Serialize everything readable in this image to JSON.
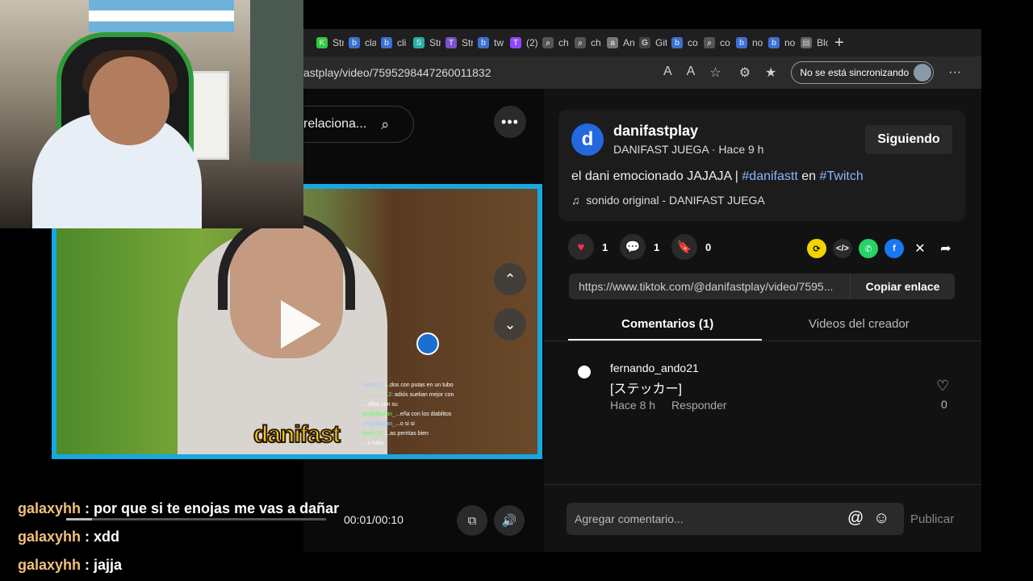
{
  "browser": {
    "tabs": [
      {
        "label": "Str",
        "color": "#2ecc40",
        "glyph": "K"
      },
      {
        "label": "cla",
        "color": "#3b6fd8",
        "glyph": "b"
      },
      {
        "label": "cli",
        "color": "#3b6fd8",
        "glyph": "b"
      },
      {
        "label": "Str",
        "color": "#20b2aa",
        "glyph": "S"
      },
      {
        "label": "Str",
        "color": "#7a4fd0",
        "glyph": "T"
      },
      {
        "label": "tw",
        "color": "#3b6fd8",
        "glyph": "b"
      },
      {
        "label": "(2)",
        "color": "#9146ff",
        "glyph": "T"
      },
      {
        "label": "ch",
        "color": "#555555",
        "glyph": "⌕"
      },
      {
        "label": "ch",
        "color": "#555555",
        "glyph": "⌕"
      },
      {
        "label": "An",
        "color": "#777777",
        "glyph": "a"
      },
      {
        "label": "Git",
        "color": "#444444",
        "glyph": "G"
      },
      {
        "label": "co",
        "color": "#3b6fd8",
        "glyph": "b"
      },
      {
        "label": "co",
        "color": "#555555",
        "glyph": "⌕"
      },
      {
        "label": "no",
        "color": "#3b6fd8",
        "glyph": "b"
      },
      {
        "label": "no",
        "color": "#3b6fd8",
        "glyph": "b"
      },
      {
        "label": "Blo",
        "color": "#666666",
        "glyph": "▤"
      }
    ],
    "url": "astplay/video/7595298447260011832",
    "sync_label": "No se está sincronizando"
  },
  "page": {
    "search_label": "relaciona...",
    "profile": {
      "avatar_letter": "d",
      "username": "danifastplay",
      "subtitle": "DANIFAST JUEGA · Hace 9 h",
      "follow_label": "Siguiendo"
    },
    "caption": {
      "text": "el dani emocionado JAJAJA | ",
      "tag1": "#danifastt",
      "mid": " en ",
      "tag2": "#Twitch"
    },
    "sound": "sonido original - DANIFAST JUEGA",
    "actions": {
      "likes": "1",
      "comments": "1",
      "saves": "0"
    },
    "share_link": "https://www.tiktok.com/@danifastplay/video/7595...",
    "copy_label": "Copiar enlace",
    "tabs": {
      "comments": "Comentarios (1)",
      "creator_videos": "Videos del creador"
    },
    "comment": {
      "user": "fernando_ando21",
      "text": "[ステッカー]",
      "time": "Hace 8 h",
      "reply": "Responder",
      "likes": "0"
    },
    "comment_input_placeholder": "Agregar comentario...",
    "publish_label": "Publicar",
    "player": {
      "time": "00:01/00:10",
      "progress": 0.1,
      "brand_text": "danifast"
    },
    "video_chat": [
      {
        "user": "lara170_",
        "msg": "...dos con putas en un tubo"
      },
      {
        "user": "................2",
        "msg": ": adiós suelian mejor con"
      },
      {
        "user": "",
        "msg": "...ellos con su"
      },
      {
        "user": "angelbazan_",
        "msg": "...eña con los diablitos"
      },
      {
        "user": "angelbazan_",
        "msg": "...o si si"
      },
      {
        "user": "lara170_",
        "msg": "...as perritas bien"
      },
      {
        "user": "",
        "msg": "...n tubo"
      }
    ]
  },
  "overlay_chat": [
    {
      "user": "galaxyhh",
      "msg": " : por que si te enojas me vas a dañar"
    },
    {
      "user": "galaxyhh",
      "msg": " : xdd"
    },
    {
      "user": "galaxyhh",
      "msg": " : jajja"
    }
  ]
}
